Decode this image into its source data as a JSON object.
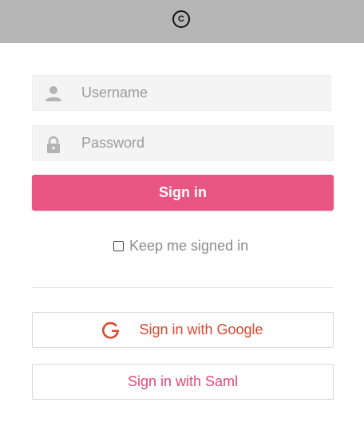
{
  "header": {
    "logo_letter": "C"
  },
  "form": {
    "username_placeholder": "Username",
    "password_placeholder": "Password",
    "signin_label": "Sign in",
    "keep_signed_in_label": "Keep me signed in"
  },
  "alternatives": {
    "google_label": "Sign in with Google",
    "saml_label": "Sign in with Saml"
  },
  "icons": {
    "user": "user-icon",
    "lock": "lock-icon",
    "google": "google-icon"
  },
  "colors": {
    "topbar": "#b5b5b5",
    "accent": "#e85582",
    "google_red": "#d9482f",
    "field_bg": "#f4f4f4"
  }
}
